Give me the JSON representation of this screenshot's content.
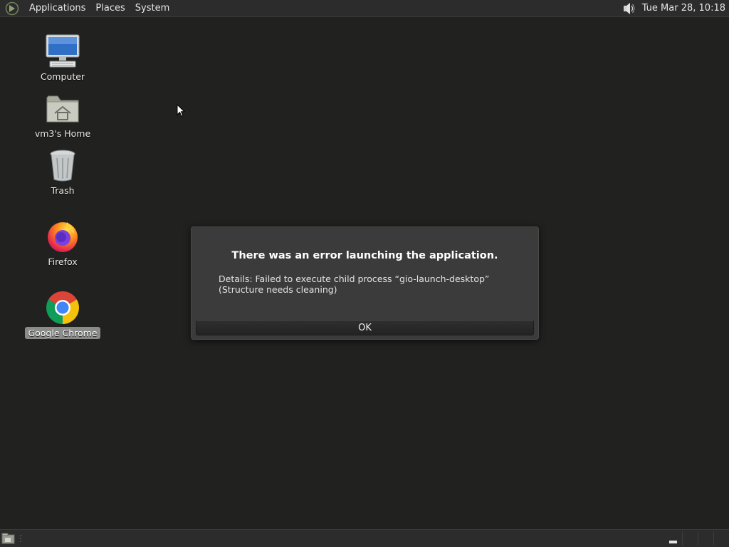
{
  "top_panel": {
    "menus": [
      "Applications",
      "Places",
      "System"
    ],
    "clock": "Tue Mar 28, 10:18",
    "icons": {
      "menu_logo": "mate-logo-icon",
      "volume": "volume-icon"
    }
  },
  "desktop_icons": [
    {
      "label": "Computer",
      "icon": "computer-icon",
      "selected": false
    },
    {
      "label": "vm3's Home",
      "icon": "home-folder-icon",
      "selected": false
    },
    {
      "label": "Trash",
      "icon": "trash-icon",
      "selected": false
    },
    {
      "label": "Firefox",
      "icon": "firefox-icon",
      "selected": false
    },
    {
      "label": "Google Chrome",
      "icon": "chrome-icon",
      "selected": true
    }
  ],
  "dialog": {
    "title": "There was an error launching the application.",
    "details": "Details: Failed to execute child process “gio-launch-desktop” (Structure needs cleaning)",
    "ok_label": "OK"
  },
  "bottom_panel": {
    "icons": {
      "show_desktop": "show-desktop-icon",
      "workspace": "workspace-switcher-icon"
    }
  },
  "colors": {
    "desktop_bg": "#212220",
    "panel_bg": "#2b2c2b",
    "dialog_bg": "#3b3b3c",
    "selected_label_bg": "#8a8c8a"
  }
}
